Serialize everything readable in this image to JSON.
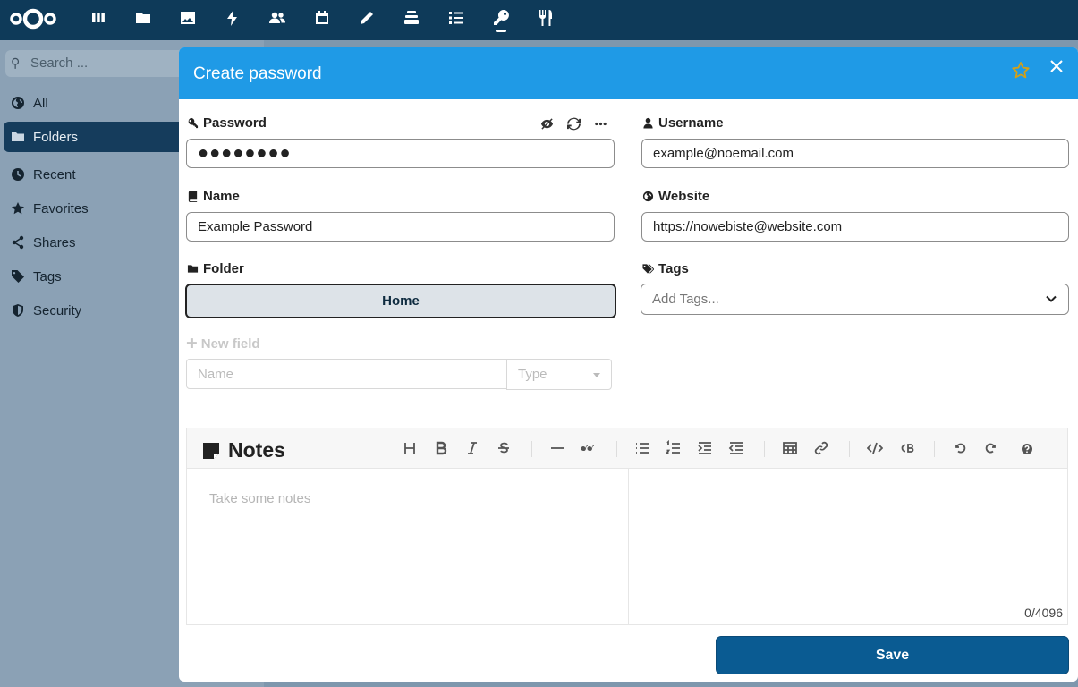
{
  "topbar": {
    "apps": [
      {
        "name": "dashboard",
        "icon": "dashboard-icon"
      },
      {
        "name": "files",
        "icon": "folder-icon"
      },
      {
        "name": "photos",
        "icon": "image-icon"
      },
      {
        "name": "activity",
        "icon": "lightning-icon"
      },
      {
        "name": "contacts",
        "icon": "contacts-icon"
      },
      {
        "name": "calendar",
        "icon": "calendar-icon"
      },
      {
        "name": "notes",
        "icon": "pencil-icon"
      },
      {
        "name": "deck",
        "icon": "deck-icon"
      },
      {
        "name": "tasks",
        "icon": "tasks-icon"
      },
      {
        "name": "passwords",
        "icon": "key-icon",
        "active": true
      },
      {
        "name": "cookbook",
        "icon": "cutlery-icon"
      }
    ]
  },
  "sidebar": {
    "search_placeholder": "Search ...",
    "items": [
      {
        "label": "All",
        "icon": "globe-icon"
      },
      {
        "label": "Folders",
        "icon": "folder-icon",
        "active": true
      },
      {
        "label": "Recent",
        "icon": "clock-icon"
      },
      {
        "label": "Favorites",
        "icon": "star-icon"
      },
      {
        "label": "Shares",
        "icon": "share-icon"
      },
      {
        "label": "Tags",
        "icon": "tag-icon"
      },
      {
        "label": "Security",
        "icon": "shield-icon"
      }
    ]
  },
  "modal": {
    "title": "Create password",
    "favorite": false,
    "password": {
      "label": "Password",
      "value": "●●●●●●●●"
    },
    "username": {
      "label": "Username",
      "value": "example@noemail.com"
    },
    "name": {
      "label": "Name",
      "value": "Example Password"
    },
    "website": {
      "label": "Website",
      "value": "https://nowebiste@website.com"
    },
    "folder": {
      "label": "Folder",
      "value": "Home"
    },
    "tags": {
      "label": "Tags",
      "placeholder": "Add Tags..."
    },
    "new_field": {
      "label": "New field",
      "name_placeholder": "Name",
      "type_placeholder": "Type"
    },
    "notes": {
      "title": "Notes",
      "placeholder": "Take some notes",
      "counter": "0/4096"
    },
    "save_label": "Save"
  },
  "colors": {
    "topbar": "#0e3a59",
    "header": "#1f9ae6",
    "save": "#0a5b92",
    "star": "#d4a017"
  }
}
